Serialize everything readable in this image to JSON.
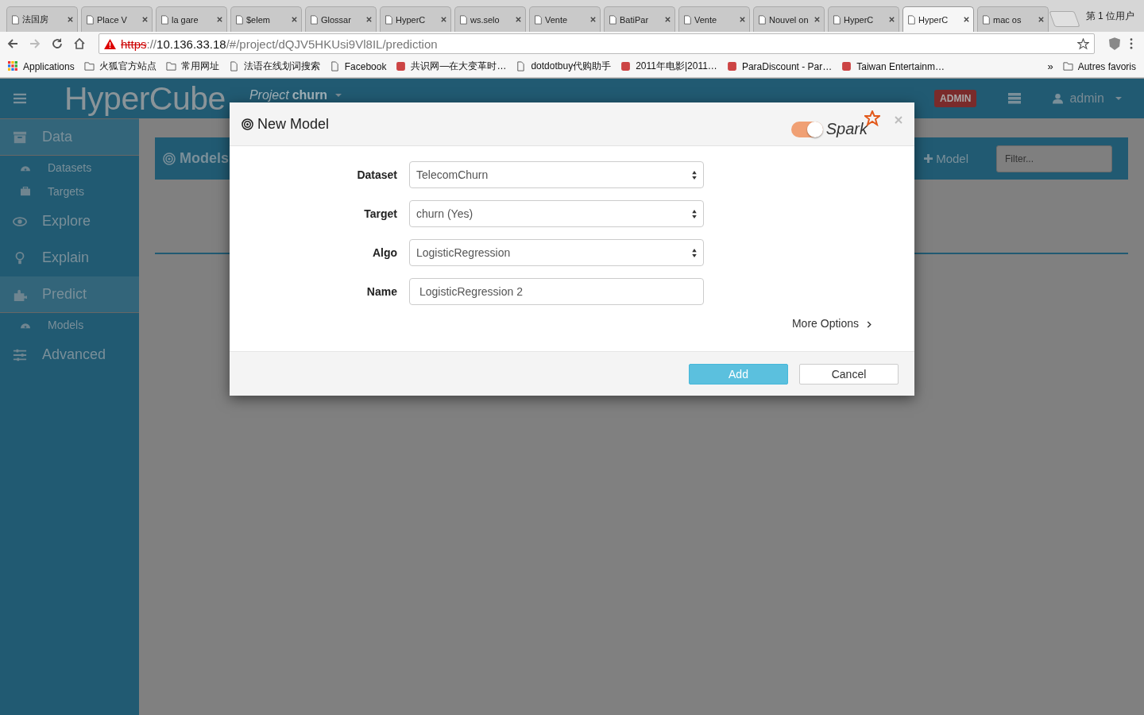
{
  "browser": {
    "tabs": [
      {
        "title": "法国房",
        "selected": false
      },
      {
        "title": "Place V",
        "selected": false
      },
      {
        "title": "la gare",
        "selected": false
      },
      {
        "title": "$elem",
        "selected": false
      },
      {
        "title": "Glossar",
        "selected": false
      },
      {
        "title": "HyperC",
        "selected": false
      },
      {
        "title": "ws.selo",
        "selected": false
      },
      {
        "title": "Vente",
        "selected": false
      },
      {
        "title": "BatiPar",
        "selected": false
      },
      {
        "title": "Vente",
        "selected": false
      },
      {
        "title": "Nouvel on",
        "selected": false
      },
      {
        "title": "HyperC",
        "selected": false
      },
      {
        "title": "HyperC",
        "selected": true
      },
      {
        "title": "mac os",
        "selected": false
      }
    ],
    "profile": "第 1 位用户",
    "address": {
      "scheme": "https",
      "separator": "://",
      "host": "10.136.33.18",
      "path": "/#/project/dQJV5HKUsi9Vl8IL/prediction"
    },
    "bookmarks": [
      {
        "label": "Applications",
        "kind": "apps"
      },
      {
        "label": "火狐官方站点",
        "kind": "folder"
      },
      {
        "label": "常用网址",
        "kind": "folder"
      },
      {
        "label": "法语在线划词搜索",
        "kind": "page"
      },
      {
        "label": "Facebook",
        "kind": "page"
      },
      {
        "label": "共识网—在大变革时…",
        "kind": "site"
      },
      {
        "label": "dotdotbuy代购助手",
        "kind": "page"
      },
      {
        "label": "2011年电影|2011…",
        "kind": "site"
      },
      {
        "label": "ParaDiscount - Par…",
        "kind": "site"
      },
      {
        "label": "Taiwan Entertainm…",
        "kind": "site"
      }
    ],
    "more_bookmarks": "»",
    "other_bookmarks": "Autres favoris"
  },
  "app": {
    "brand": "HyperCube",
    "project": {
      "label": "Project",
      "name": "churn"
    },
    "badge": "ADMIN",
    "user": "admin"
  },
  "sidebar": [
    {
      "label": "Data",
      "expanded": true,
      "children": [
        {
          "label": "Datasets"
        },
        {
          "label": "Targets"
        }
      ]
    },
    {
      "label": "Explore",
      "expanded": false
    },
    {
      "label": "Explain",
      "expanded": false
    },
    {
      "label": "Predict",
      "expanded": true,
      "children": [
        {
          "label": "Models"
        }
      ]
    },
    {
      "label": "Advanced",
      "expanded": false
    }
  ],
  "panel": {
    "title": "Models",
    "add_button": "Model",
    "filter": {
      "placeholder": "Filter..."
    }
  },
  "modal": {
    "title": "New Model",
    "spark": {
      "on": true,
      "label": "Spark"
    },
    "fields": [
      {
        "label": "Dataset",
        "kind": "select",
        "value": "TelecomChurn"
      },
      {
        "label": "Target",
        "kind": "select",
        "value": "churn (Yes)"
      },
      {
        "label": "Algo",
        "kind": "select",
        "value": "LogisticRegression"
      },
      {
        "label": "Name",
        "kind": "text",
        "value": "LogisticRegression 2"
      }
    ],
    "more_options": "More Options",
    "buttons": [
      {
        "label": "Add",
        "kind": "primary"
      },
      {
        "label": "Cancel",
        "kind": "default"
      }
    ]
  }
}
